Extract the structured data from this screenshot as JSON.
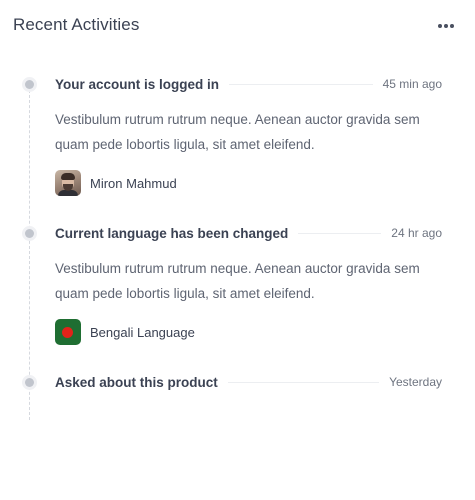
{
  "card": {
    "title": "Recent Activities"
  },
  "activities": [
    {
      "title": "Your account is logged in",
      "time": "45 min ago",
      "description": "Vestibulum rutrum rutrum neque. Aenean auctor gravida sem quam pede lobortis ligula, sit amet eleifend.",
      "meta": {
        "type": "avatar",
        "label": "Miron Mahmud"
      }
    },
    {
      "title": "Current language has been changed",
      "time": "24 hr ago",
      "description": "Vestibulum rutrum rutrum neque. Aenean auctor gravida sem quam pede lobortis ligula, sit amet eleifend.",
      "meta": {
        "type": "flag",
        "label": "Bengali Language"
      }
    },
    {
      "title": "Asked about this product",
      "time": "Yesterday",
      "description": ""
    }
  ],
  "colors": {
    "title": "#3b4253",
    "body_text": "#5e6472",
    "timeline_dot": "#c1c5cd",
    "flag_green": "#1f6e32",
    "flag_red": "#e2231a"
  },
  "icons": {
    "more": "more-horizontal-icon"
  }
}
